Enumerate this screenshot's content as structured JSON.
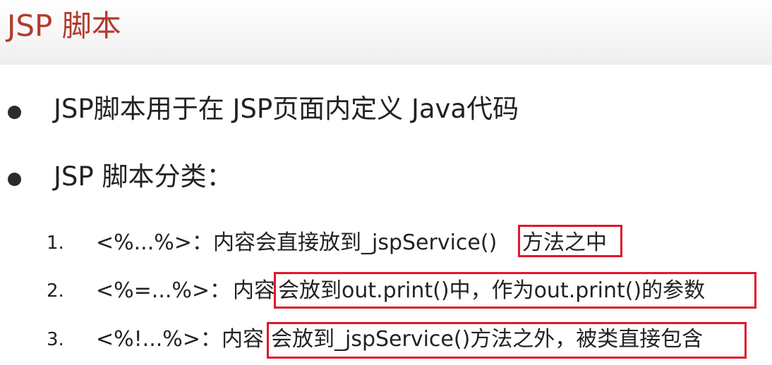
{
  "title": "JSP 脚本",
  "bullets": [
    "JSP脚本用于在 JSP页面内定义 Java代码",
    "JSP 脚本分类："
  ],
  "items": [
    {
      "number": "1.",
      "syntax": "<%...%>：",
      "prefix": "内容会直接放到_jspService()",
      "highlight": "方法之中"
    },
    {
      "number": "2.",
      "syntax": "<%=...%>：",
      "prefix": "内容",
      "highlight": "会放到out.print()中，作为out.print()的参数"
    },
    {
      "number": "3.",
      "syntax": "<%!...%>：",
      "prefix": "内容",
      "highlight": "会放到_jspService()方法之外，被类直接包含"
    }
  ],
  "colors": {
    "title": "#b23b2e",
    "highlight_border": "#e0162b"
  }
}
